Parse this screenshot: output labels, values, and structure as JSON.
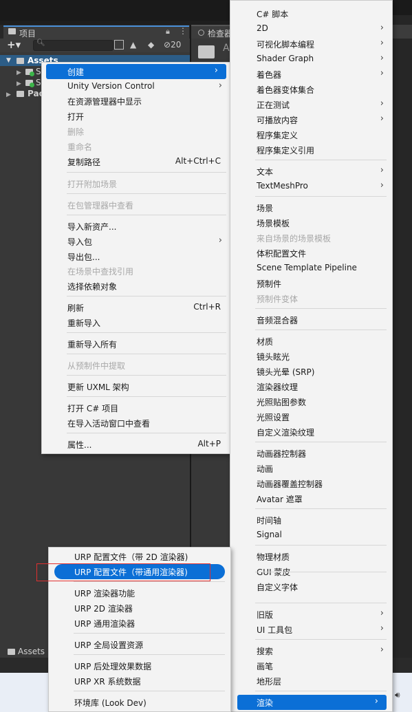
{
  "project_panel": {
    "tab_label": "项目",
    "hidden_count": "20",
    "tree": {
      "root_label": "Assets",
      "children": [
        "S",
        "S"
      ],
      "packages_label": "Pac"
    },
    "bottom_breadcrumb": "Assets"
  },
  "inspector_panel": {
    "tab_label": "检查器",
    "letter": "A"
  },
  "context_menu": {
    "items": [
      {
        "label": "创建",
        "submenu": true,
        "highlighted": true
      },
      {
        "label": "Unity Version Control",
        "submenu": true
      },
      {
        "label": "在资源管理器中显示"
      },
      {
        "label": "打开"
      },
      {
        "label": "删除",
        "disabled": true
      },
      {
        "label": "重命名",
        "disabled": true
      },
      {
        "label": "复制路径",
        "shortcut": "Alt+Ctrl+C"
      },
      {
        "label": "打开附加场景",
        "disabled": true
      },
      {
        "label": "在包管理器中查看",
        "disabled": true
      },
      {
        "label": "导入新资产..."
      },
      {
        "label": "导入包",
        "submenu": true
      },
      {
        "label": "导出包..."
      },
      {
        "label": "在场景中查找引用",
        "disabled": true
      },
      {
        "label": "选择依赖对象"
      },
      {
        "label": "刷新",
        "shortcut": "Ctrl+R"
      },
      {
        "label": "重新导入"
      },
      {
        "label": "重新导入所有"
      },
      {
        "label": "从预制件中提取",
        "disabled": true
      },
      {
        "label": "更新 UXML 架构"
      },
      {
        "label": "打开 C# 项目"
      },
      {
        "label": "在导入活动窗口中查看"
      },
      {
        "label": "属性...",
        "shortcut": "Alt+P"
      }
    ]
  },
  "create_menu": {
    "items": [
      {
        "label": "C# 脚本"
      },
      {
        "label": "2D",
        "submenu": true
      },
      {
        "label": "可视化脚本编程",
        "submenu": true
      },
      {
        "label": "Shader Graph",
        "submenu": true
      },
      {
        "label": "着色器",
        "submenu": true
      },
      {
        "label": "着色器变体集合"
      },
      {
        "label": "正在测试",
        "submenu": true
      },
      {
        "label": "可播放内容",
        "submenu": true
      },
      {
        "label": "程序集定义"
      },
      {
        "label": "程序集定义引用"
      },
      {
        "label": "文本",
        "submenu": true
      },
      {
        "label": "TextMeshPro",
        "submenu": true
      },
      {
        "label": "场景"
      },
      {
        "label": "场景模板"
      },
      {
        "label": "来自场景的场景模板",
        "disabled": true
      },
      {
        "label": "体积配置文件"
      },
      {
        "label": "Scene Template Pipeline"
      },
      {
        "label": "预制件"
      },
      {
        "label": "预制件变体",
        "disabled": true
      },
      {
        "label": "音频混合器"
      },
      {
        "label": "材质"
      },
      {
        "label": "镜头眩光"
      },
      {
        "label": "镜头光晕 (SRP)"
      },
      {
        "label": "渲染器纹理"
      },
      {
        "label": "光照贴图参数"
      },
      {
        "label": "光照设置"
      },
      {
        "label": "自定义渲染纹理"
      },
      {
        "label": "动画器控制器"
      },
      {
        "label": "动画"
      },
      {
        "label": "动画器覆盖控制器"
      },
      {
        "label": "Avatar 遮罩"
      },
      {
        "label": "时间轴"
      },
      {
        "label": "Signal"
      },
      {
        "label": "物理材质"
      },
      {
        "label": "GUI 蒙皮"
      },
      {
        "label": "自定义字体"
      },
      {
        "label": "旧版",
        "submenu": true
      },
      {
        "label": "UI 工具包",
        "submenu": true
      },
      {
        "label": "搜索",
        "submenu": true
      },
      {
        "label": "画笔"
      },
      {
        "label": "地形层"
      },
      {
        "label": "渲染",
        "submenu": true,
        "highlighted": true
      }
    ]
  },
  "render_menu": {
    "items": [
      {
        "label": "URP 配置文件（带 2D 渲染器)"
      },
      {
        "label": "URP 配置文件（带通用渲染器)",
        "highlighted": true
      },
      {
        "label": "URP 渲染器功能"
      },
      {
        "label": "URP 2D 渲染器"
      },
      {
        "label": "URP 通用渲染器"
      },
      {
        "label": "URP 全局设置资源"
      },
      {
        "label": "URP 后处理效果数据"
      },
      {
        "label": "URP XR 系统数据"
      },
      {
        "label": "环境库 (Look Dev)"
      }
    ]
  },
  "colors": {
    "highlight": "#0b6fd6",
    "annotation": "#e03030",
    "selected_row": "#2c5d87"
  }
}
